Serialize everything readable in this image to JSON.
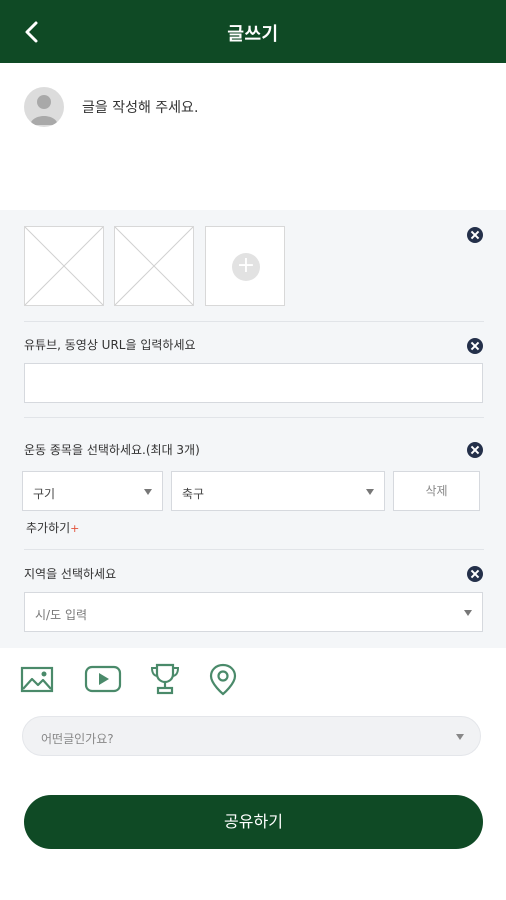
{
  "header": {
    "title": "글쓰기"
  },
  "composer": {
    "prompt": "글을 작성해 주세요."
  },
  "media": {
    "add_symbol": "+"
  },
  "video": {
    "label": "유튜브, 동영상 URL을 입력하세요",
    "value": ""
  },
  "sports": {
    "label": "운동 종목을 선택하세요.(최대 3개)",
    "select1": "구기",
    "select2": "축구",
    "delete_label": "삭제",
    "add_label": "추가하기",
    "add_plus": "+"
  },
  "region": {
    "label": "지역을 선택하세요",
    "placeholder": "시/도 입력"
  },
  "toolbar": {
    "icons": [
      "image-icon",
      "youtube-icon",
      "trophy-icon",
      "location-pin-icon"
    ]
  },
  "category": {
    "placeholder": "어떤글인가요?"
  },
  "submit": {
    "label": "공유하기"
  },
  "colors": {
    "brand": "#0f4a25",
    "accent_icon": "#4a8a6a",
    "close": "#24304a",
    "plus_red": "#e2523b"
  }
}
